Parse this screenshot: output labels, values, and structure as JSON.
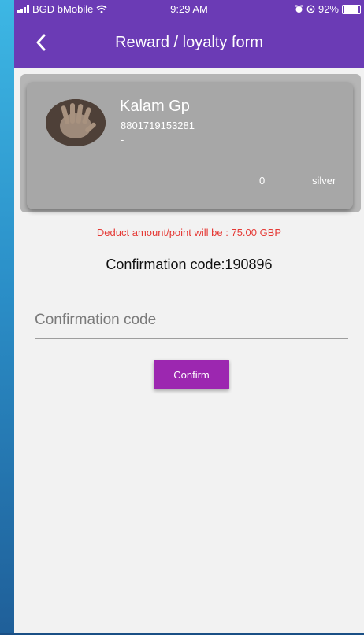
{
  "status_bar": {
    "carrier": "BGD bMobile",
    "time": "9:29 AM",
    "battery": "92%",
    "battery_level": 0.92
  },
  "app_bar": {
    "title": "Reward / loyalty form",
    "back_icon": "chevron-left-icon"
  },
  "profile_card": {
    "name": "Kalam Gp",
    "phone": "8801719153281",
    "subtitle": "-",
    "points": "0",
    "tier": "silver"
  },
  "deduct_text": "Deduct amount/point will be  : 75.00 GBP",
  "confirmation_code_text": "Confirmation code:190896",
  "confirmation_input": {
    "placeholder": "Confirmation code",
    "value": ""
  },
  "confirm_button": {
    "label": "Confirm"
  },
  "colors": {
    "app_bar": "#6b3bb5",
    "button": "#9c27b0",
    "deduct_text": "#e53935",
    "card": "#a7a7a7"
  }
}
